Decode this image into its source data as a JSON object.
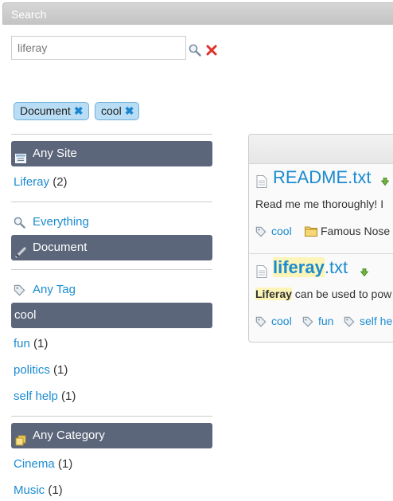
{
  "portlet": {
    "title": "Search"
  },
  "search": {
    "value": "liferay"
  },
  "selected_facets": [
    {
      "label": "Document",
      "remove": "✖"
    },
    {
      "label": "cool",
      "remove": "✖"
    }
  ],
  "site_facet": {
    "header": "Any Site",
    "items": [
      {
        "label": "Liferay",
        "count": "(2)"
      }
    ]
  },
  "type_facet": {
    "link": "Everything",
    "selected": "Document"
  },
  "tag_facet": {
    "link": "Any Tag",
    "selected": "cool",
    "items": [
      {
        "label": "fun",
        "count": "(1)"
      },
      {
        "label": "politics",
        "count": "(1)"
      },
      {
        "label": "self help",
        "count": "(1)"
      }
    ]
  },
  "category_facet": {
    "header": "Any Category",
    "items": [
      {
        "label": "Cinema",
        "count": "(1)"
      },
      {
        "label": "Music",
        "count": "(1)"
      }
    ]
  },
  "results": [
    {
      "title": "README.txt",
      "title_hl": "",
      "title_rest": "README.txt",
      "snippet_hl": "",
      "snippet": "Read me me thoroughly! I",
      "tags": [
        "cool"
      ],
      "folder": "Famous Nose"
    },
    {
      "title_hl": "liferay",
      "title_rest": ".txt",
      "snippet_hl": "Liferay",
      "snippet": " can be used to pow",
      "tags": [
        "cool",
        "fun",
        "self he"
      ]
    }
  ],
  "colors": {
    "link": "#1b8bd0",
    "facet_header": "#5b667a",
    "chip_bg": "#b9ddf4",
    "highlight": "#fdf5b8"
  }
}
